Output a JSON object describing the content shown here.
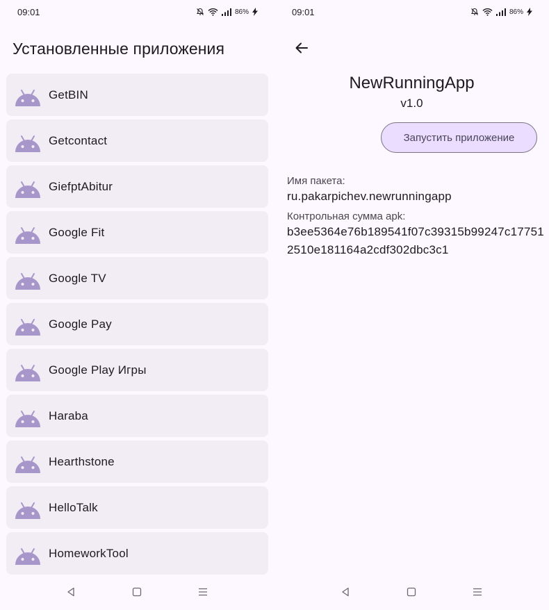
{
  "colors": {
    "background": "#fdf7ff",
    "list_item_bg": "#f2ecf5",
    "android_icon": "#a796c9",
    "button_bg": "#eaddff",
    "button_text": "#4a4458"
  },
  "status_bar": {
    "time": "09:01",
    "battery": "86%",
    "icons": [
      "mute-icon",
      "wifi-icon",
      "signal-icon",
      "battery-charging-icon"
    ]
  },
  "list_screen": {
    "title": "Установленные приложения",
    "apps": [
      {
        "label": "GetBIN",
        "icon": "android-icon"
      },
      {
        "label": "Getcontact",
        "icon": "android-icon"
      },
      {
        "label": "GiefptAbitur",
        "icon": "android-icon"
      },
      {
        "label": "Google Fit",
        "icon": "android-icon"
      },
      {
        "label": "Google TV",
        "icon": "android-icon"
      },
      {
        "label": "Google Pay",
        "icon": "android-icon"
      },
      {
        "label": "Google Play Игры",
        "icon": "android-icon"
      },
      {
        "label": "Haraba",
        "icon": "android-icon"
      },
      {
        "label": "Hearthstone",
        "icon": "android-icon"
      },
      {
        "label": "HelloTalk",
        "icon": "android-icon"
      },
      {
        "label": "HomeworkTool",
        "icon": "android-icon"
      }
    ]
  },
  "detail_screen": {
    "back_icon": "arrow-left-icon",
    "app_name": "NewRunningApp",
    "version": "v1.0",
    "launch_button": "Запустить приложение",
    "package_label": "Имя пакета:",
    "package_value": "ru.pakarpichev.newrunningapp",
    "checksum_label": "Контрольная сумма apk:",
    "checksum_value": "b3ee5364e76b189541f07c39315b99247c177512510e181164a2cdf302dbc3c1"
  },
  "nav_bar": {
    "icons": [
      "back-triangle-icon",
      "home-square-icon",
      "menu-lines-icon"
    ]
  }
}
